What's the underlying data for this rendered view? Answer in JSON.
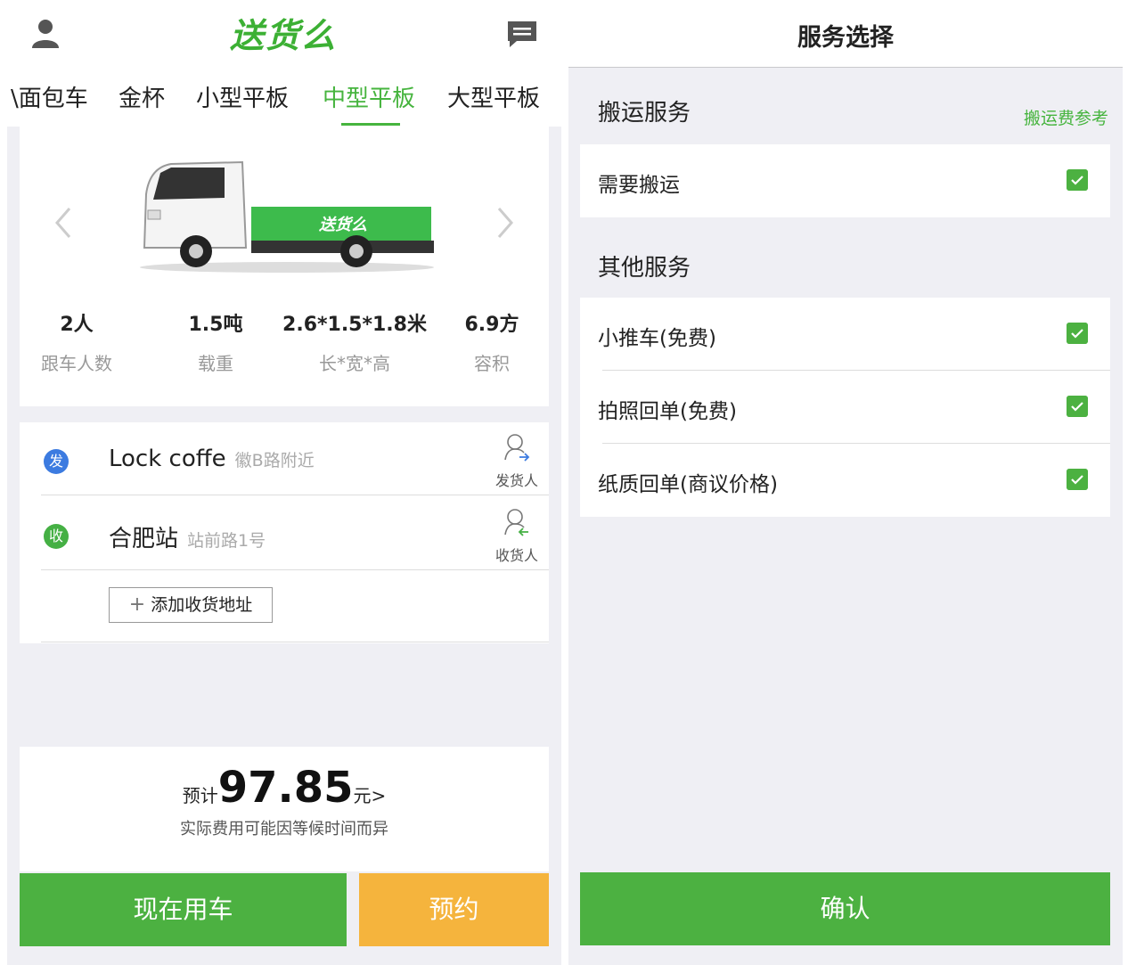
{
  "left": {
    "logo": "送货么",
    "vehicle_tabs": [
      "\\面包车",
      "金杯",
      "小型平板",
      "中型平板",
      "大型平板"
    ],
    "active_tab": "中型平板",
    "truck_logo": "送货么",
    "specs": [
      {
        "value": "2人",
        "label": "跟车人数"
      },
      {
        "value": "1.5吨",
        "label": "载重"
      },
      {
        "value": "2.6*1.5*1.8米",
        "label": "长*宽*高"
      },
      {
        "value": "6.9方",
        "label": "容积"
      }
    ],
    "addresses": [
      {
        "badge": "发",
        "badge_color": "#3c7be0",
        "name": "Lock coffe",
        "sub": "徽B路附近",
        "person_label": "发货人"
      },
      {
        "badge": "收",
        "badge_color": "#45b044",
        "name": "合肥站",
        "sub": "站前路1号",
        "person_label": "收货人"
      }
    ],
    "add_address_label": "添加收货地址",
    "price_prefix": "预计",
    "price_value": "97.85",
    "price_suffix": "元>",
    "price_note": "实际费用可能因等候时间而异",
    "use_now_label": "现在用车",
    "reserve_label": "预约"
  },
  "right": {
    "title": "服务选择",
    "sections": [
      {
        "title": "搬运服务",
        "link": "搬运费参考",
        "options": [
          {
            "label": "需要搬运",
            "checked": true
          }
        ]
      },
      {
        "title": "其他服务",
        "options": [
          {
            "label": "小推车(免费)",
            "checked": true
          },
          {
            "label": "拍照回单(免费)",
            "checked": true
          },
          {
            "label": "纸质回单(商议价格)",
            "checked": true
          }
        ]
      }
    ],
    "confirm_label": "确认"
  },
  "colors": {
    "brand_green": "#4cb141",
    "reserve_orange": "#f5b43d",
    "accent_green": "#46b43e"
  }
}
